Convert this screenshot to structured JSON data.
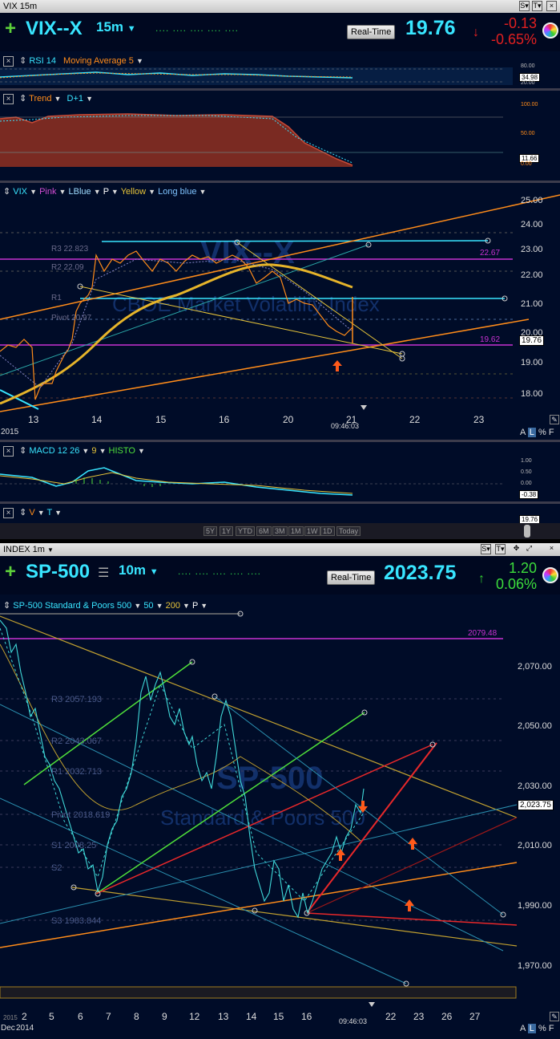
{
  "vix_window": {
    "title": "VIX 15m",
    "symbol": "VIX--X",
    "interval": "15m",
    "realtime_label": "Real-Time",
    "last_price": "19.76",
    "change": "-0.13",
    "change_pct": "-0.65%",
    "rsi_panel": {
      "label1": "RSI 14",
      "label2": "Moving Average 5",
      "ticks": [
        "80.00",
        "34.98",
        "20.00"
      ]
    },
    "trend_panel": {
      "label1": "Trend",
      "label2": "D+1",
      "ticks": [
        "100.00",
        "50.00",
        "11.66",
        "0.00"
      ]
    },
    "main_panel": {
      "legend": [
        "VIX",
        "Pink",
        "LBlue",
        "P",
        "Yellow",
        "Long blue"
      ],
      "y_ticks": [
        "25.00",
        "24.00",
        "23.00",
        "22.00",
        "21.00",
        "20.00",
        "19.00",
        "18.00"
      ],
      "x_ticks": [
        "13",
        "14",
        "15",
        "16",
        "20",
        "21",
        "22",
        "23"
      ],
      "year": "2015",
      "time": "09:46:03",
      "current": "19.76",
      "level_labels": [
        "22.67",
        "19.62"
      ],
      "pivot_labels": [
        "R3 22.823",
        "R2 22.09",
        "R1",
        "Pivot 20.97"
      ],
      "watermark": "VIX--X",
      "watermark2": "CBOE Market Volatility Index"
    },
    "macd_panel": {
      "label1": "MACD 12 26",
      "label2": "9",
      "label3": "HISTO",
      "ticks": [
        "1.00",
        "0.50",
        "0.00",
        "-0.38"
      ]
    },
    "vt_panel": {
      "label1": "V",
      "label2": "T",
      "tick": "19.76"
    },
    "range_buttons": [
      "5Y",
      "1Y",
      "YTD",
      "6M",
      "3M",
      "1M",
      "1W",
      "1D",
      "Today"
    ],
    "footer_btns": [
      "A",
      "L",
      "%",
      "F"
    ]
  },
  "spx_window": {
    "title": "INDEX 1m",
    "symbol": "SP-500",
    "interval": "10m",
    "realtime_label": "Real-Time",
    "last_price": "2023.75",
    "change": "1.20",
    "change_pct": "0.06%",
    "main_panel": {
      "legend": [
        "SP-500 Standard & Poors 500",
        "50",
        "200",
        "P"
      ],
      "y_ticks": [
        "2,070.00",
        "2,050.00",
        "2,030.00",
        "2,010.00",
        "1,990.00",
        "1,970.00"
      ],
      "x_ticks": [
        "2",
        "5",
        "6",
        "7",
        "8",
        "9",
        "12",
        "13",
        "14",
        "15",
        "16",
        "22",
        "23",
        "26",
        "27"
      ],
      "month": "Dec",
      "year": "2014",
      "year2": "2015",
      "time": "09:46:03",
      "current": "2,023.75",
      "level_label": "2079.48",
      "pivot_labels": [
        "R3 2057.193",
        "R2 2043.067",
        "R1 2032.713",
        "Pivot 2018.619",
        "S1 2008.25",
        "S2",
        "S3 1983.844"
      ],
      "watermark": "SP-500",
      "watermark2": "Standard & Poors 500"
    },
    "footer_btns": [
      "A",
      "L",
      "%",
      "F"
    ]
  },
  "colors": {
    "cyan": "#38e5ff",
    "orange": "#ff8c1a",
    "magenta": "#c832d2",
    "yellow": "#e6c43a",
    "red": "#e8282a",
    "green": "#4fe03a"
  }
}
